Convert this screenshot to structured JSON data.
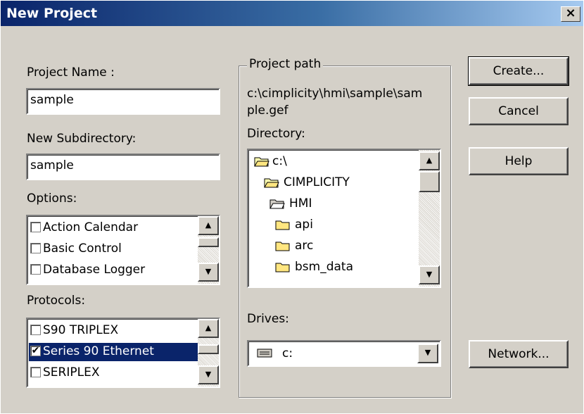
{
  "window": {
    "title": "New Project",
    "close_glyph": "×"
  },
  "project_name": {
    "label": "Project Name :",
    "value": "sample"
  },
  "subdirectory": {
    "label": "New Subdirectory:",
    "value": "sample"
  },
  "options": {
    "label": "Options:",
    "items": [
      {
        "label": "Action Calendar",
        "checked": false
      },
      {
        "label": "Basic Control",
        "checked": false
      },
      {
        "label": "Database Logger",
        "checked": false
      }
    ]
  },
  "protocols": {
    "label": "Protocols:",
    "items": [
      {
        "label": "S90 TRIPLEX",
        "checked": false
      },
      {
        "label": "Series 90 Ethernet",
        "checked": true,
        "selected": true
      },
      {
        "label": "SERIPLEX",
        "checked": false
      }
    ]
  },
  "project_path": {
    "legend": "Project path",
    "path_line1": "c:\\cimplicity\\hmi\\sample\\sam",
    "path_line2": "ple.gef"
  },
  "directory": {
    "label": "Directory:",
    "items": [
      {
        "label": "c:\\",
        "icon": "open-folder-icon"
      },
      {
        "label": "CIMPLICITY",
        "icon": "open-folder-icon"
      },
      {
        "label": "HMI",
        "icon": "open-folder-icon"
      },
      {
        "label": "api",
        "icon": "folder-icon"
      },
      {
        "label": "arc",
        "icon": "folder-icon"
      },
      {
        "label": "bsm_data",
        "icon": "folder-icon"
      }
    ]
  },
  "drives": {
    "label": "Drives:",
    "value": "c:",
    "icon": "drive-icon"
  },
  "buttons": {
    "create": "Create...",
    "cancel": "Cancel",
    "help": "Help",
    "network": "Network..."
  },
  "glyphs": {
    "up": "▲",
    "down": "▼",
    "check": "✔"
  },
  "colors": {
    "title_start": "#0a246a",
    "title_end": "#a6caf0",
    "selection": "#0a246a",
    "face": "#d4d0c8"
  }
}
